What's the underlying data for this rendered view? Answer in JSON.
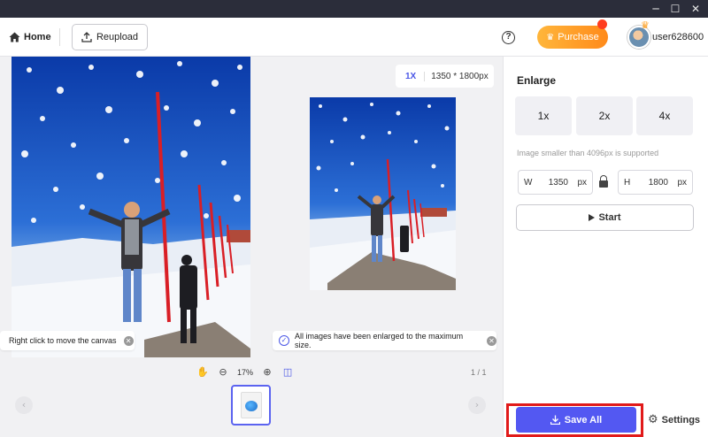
{
  "window": {
    "minimize_icon": "minimize-icon",
    "maximize_icon": "maximize-icon",
    "close_icon": "close-icon"
  },
  "topbar": {
    "home_label": "Home",
    "reupload_label": "Reupload",
    "help_icon": "help-icon",
    "purchase_label": "Purchase",
    "username": "user628600"
  },
  "preview": {
    "scale_badge": "1X",
    "dimensions": "1350 * 1800px",
    "toast_left": "Right click to move the canvas",
    "toast_right": "All images have been enlarged to the maximum size.",
    "zoom_level": "17%",
    "page_count": "1 / 1"
  },
  "panel": {
    "title": "Enlarge",
    "scales": [
      "1x",
      "2x",
      "4x"
    ],
    "hint": "Image smaller than 4096px is supported",
    "width_label": "W",
    "width_value": "1350",
    "width_unit": "px",
    "height_label": "H",
    "height_value": "1800",
    "height_unit": "px",
    "start_label": "Start",
    "save_all_label": "Save All",
    "settings_label": "Settings"
  },
  "colors": {
    "accent": "#5358f2",
    "highlight_frame": "#e11a1a",
    "purchase": "#ff9d2a"
  }
}
